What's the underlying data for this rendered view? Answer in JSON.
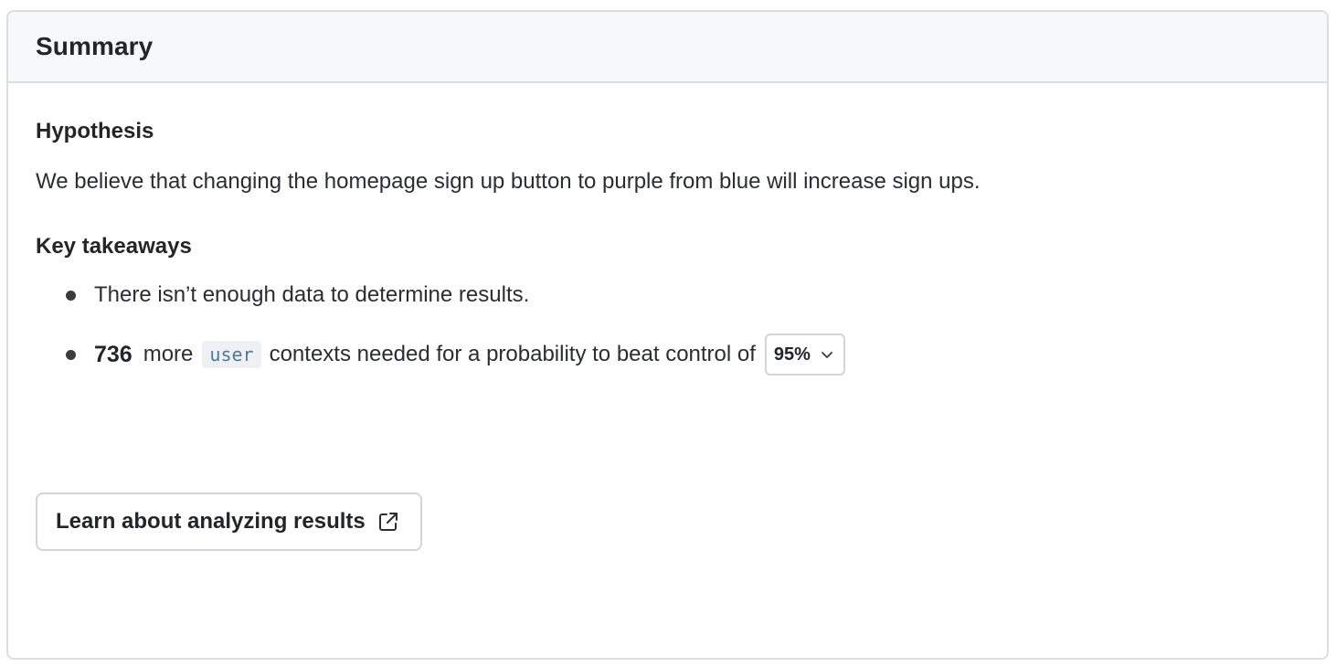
{
  "header": {
    "title": "Summary"
  },
  "hypothesis": {
    "title": "Hypothesis",
    "text": "We believe that changing the homepage sign up button to purple from blue will increase sign ups."
  },
  "key_takeaways": {
    "title": "Key takeaways",
    "item_1": "There isn’t enough data to determine results.",
    "item_2": {
      "count": "736",
      "before_chip": "more",
      "chip": "user",
      "after_chip": "contexts needed for a probability to beat control of",
      "threshold_selected": "95%"
    }
  },
  "learn_button": {
    "label": "Learn about analyzing results",
    "icon": "external-link-icon"
  },
  "colors": {
    "border": "#dcdde1",
    "header_bg": "#f7f8fa",
    "text": "#23252a",
    "chip_text": "#4b7a9a",
    "chip_bg": "#eef0f3"
  }
}
